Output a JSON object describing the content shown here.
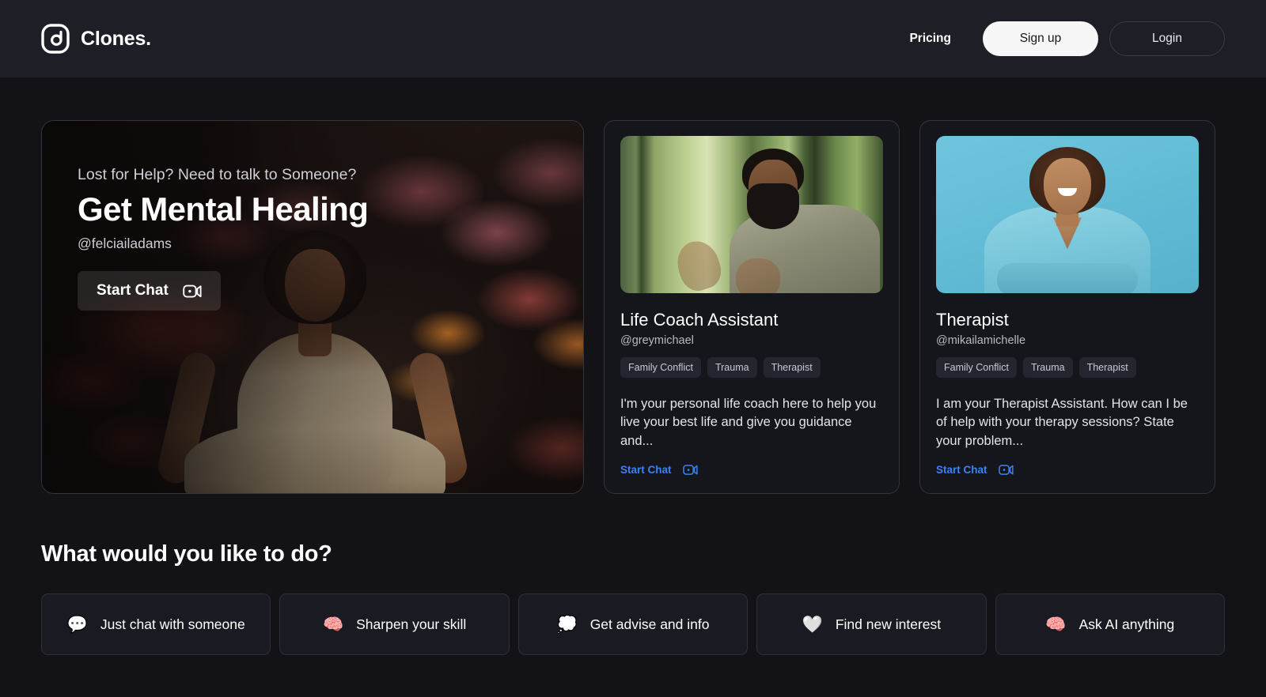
{
  "header": {
    "brand_name": "Clones.",
    "logo_icon": "clones-logo-icon",
    "nav": {
      "pricing_label": "Pricing",
      "signup_label": "Sign up",
      "login_label": "Login"
    }
  },
  "hero": {
    "kicker": "Lost for Help?  Need to talk to Someone?",
    "title": "Get Mental Healing",
    "handle": "@felciailadams",
    "cta_label": "Start Chat",
    "cta_icon": "video-camera-icon",
    "image_alt": "woman meditating in lotus pose surrounded by flowers"
  },
  "cards": [
    {
      "title": "Life Coach Assistant",
      "handle": "@greymichael",
      "tags": [
        "Family Conflict",
        "Trauma",
        "Therapist"
      ],
      "description": "I'm your personal life coach here to help you live your best life and give you guidance and...",
      "cta_label": "Start Chat",
      "cta_icon": "video-camera-icon",
      "image_alt": "man gesturing while speaking in front of a window"
    },
    {
      "title": "Therapist",
      "handle": "@mikailamichelle",
      "tags": [
        "Family Conflict",
        "Trauma",
        "Therapist"
      ],
      "description": "I am your Therapist Assistant. How can I be of help with your therapy sessions? State your problem...",
      "cta_label": "Start Chat",
      "cta_icon": "video-camera-icon",
      "image_alt": "smiling woman in teal scrubs on blue background"
    }
  ],
  "actions": {
    "title": "What would you like to do?",
    "items": [
      {
        "label": "Just chat with someone",
        "emoji": "💬",
        "icon_name": "speech-balloon-icon"
      },
      {
        "label": "Sharpen your skill",
        "emoji": "🧠",
        "icon_name": "lightbulb-icon"
      },
      {
        "label": "Get advise and info",
        "emoji": "💭",
        "icon_name": "thought-balloon-icon"
      },
      {
        "label": "Find new interest",
        "emoji": "🤍",
        "icon_name": "heart-hand-icon"
      },
      {
        "label": "Ask AI anything",
        "emoji": "🧠",
        "icon_name": "brain-icon"
      }
    ]
  },
  "colors": {
    "page_bg": "#131317",
    "header_bg": "#1d1e26",
    "card_bg": "#15161c",
    "card_border": "#33343c",
    "link_blue": "#3b82f6",
    "signup_bg": "#f7f7f8",
    "tag_bg": "#24252f"
  }
}
